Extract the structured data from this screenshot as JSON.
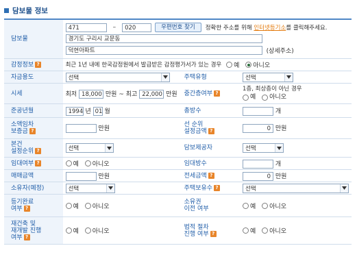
{
  "title": "담보물 정보",
  "collateral": {
    "label": "담보물",
    "zip1": "471",
    "dash": "–",
    "zip2": "020",
    "zip_button": "우편번호 찾기",
    "notice_pre": "정확한 주소를 위해 ",
    "notice_link": "인터넷등기소",
    "notice_post": "를 클릭해주세요.",
    "address1": "경기도 구리시  교문동",
    "address2": "덕현아파트",
    "detail_hint": "(상세주소)"
  },
  "appraisal": {
    "label": "감정정보",
    "text": "최근 1년 내에 한국감정원에서 발급받은 감정평가서가 있는 경우",
    "yes": "예",
    "no": "아니오",
    "selected": "no"
  },
  "fund_use": {
    "label": "자금용도",
    "value": "선택"
  },
  "housing_type": {
    "label": "주택유형",
    "value": "선택"
  },
  "market_price": {
    "label": "시세",
    "min_label": "최저",
    "min_value": "18,000",
    "unit": "만원",
    "sep": "~",
    "max_label": "최고",
    "max_value": "22,000",
    "unit2": "만원"
  },
  "middle_floor": {
    "label": "중간층여부",
    "text": "1층, 최상층이 아닌 경우",
    "yes": "예",
    "no": "아니오"
  },
  "completion": {
    "label": "준공년월",
    "year": "1994",
    "year_unit": "년",
    "month": "01",
    "month_unit": "월"
  },
  "total_households": {
    "label": "총방수",
    "value": "",
    "unit": "개"
  },
  "small_lease": {
    "label1": "소액임차",
    "label2": "보증금",
    "value": "",
    "unit": "만원"
  },
  "senior_lien": {
    "label1": "선 순위",
    "label2": "설정금액",
    "value": "0",
    "unit": "만원"
  },
  "priority": {
    "label1": "본건",
    "label2": "설정순위",
    "value": "선택"
  },
  "provider": {
    "label": "담보제공자",
    "value": "선택"
  },
  "lease": {
    "label": "임대여부",
    "yes": "예",
    "no": "아니오"
  },
  "lease_rooms": {
    "label": "임대방수",
    "value": "",
    "unit": "개"
  },
  "sale_price": {
    "label": "매매금액",
    "value": "",
    "unit": "만원"
  },
  "deposit": {
    "label": "전세금액",
    "value": "0",
    "unit": "만원"
  },
  "owner": {
    "label": "소유자(예정)",
    "value": "선택"
  },
  "houses_owned": {
    "label": "주택보유수",
    "value": "선택"
  },
  "registration": {
    "label1": "등기완료",
    "label2": "여부",
    "yes": "예",
    "no": "아니오"
  },
  "ownership_transfer": {
    "label1": "소유권",
    "label2": "이전 여부",
    "yes": "예",
    "no": "아니오"
  },
  "redevelopment": {
    "label1": "재건축 및",
    "label2": "재개발 진행",
    "label3": "여부",
    "yes": "예",
    "no": "아니오"
  },
  "legal_procedure": {
    "label1": "법적 절차",
    "label2": "진행 여부",
    "yes": "예",
    "no": "아니오"
  }
}
